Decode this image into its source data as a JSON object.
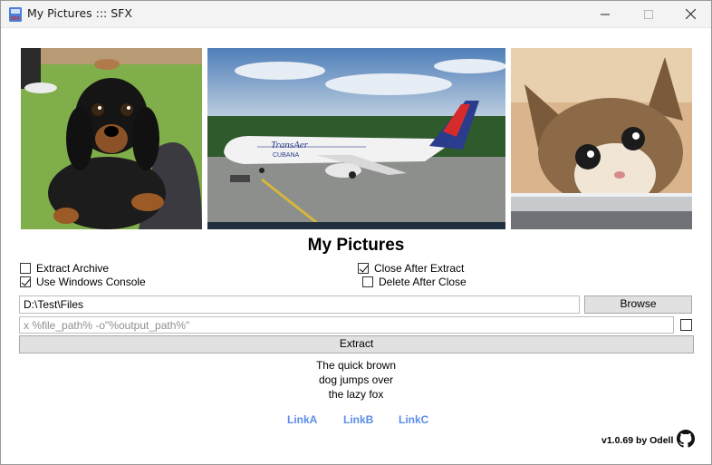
{
  "window": {
    "title": "My Pictures ::: SFX"
  },
  "images": [
    {
      "name": "dachshund-puppy-photo"
    },
    {
      "name": "airplane-photo"
    },
    {
      "name": "kitten-photo"
    }
  ],
  "heading": "My Pictures",
  "options": {
    "extract_archive": {
      "label": "Extract Archive",
      "checked": false
    },
    "use_windows_console": {
      "label": "Use Windows Console",
      "checked": true
    },
    "close_after_extract": {
      "label": "Close After Extract",
      "checked": true
    },
    "delete_after_close": {
      "label": "Delete After Close",
      "checked": false
    }
  },
  "path": {
    "value": "D:\\Test\\Files"
  },
  "browse_label": "Browse",
  "command": {
    "placeholder": "x %file_path% -o\"%output_path%\""
  },
  "extract_label": "Extract",
  "description": [
    "The quick brown",
    "dog jumps over",
    "the lazy fox"
  ],
  "links": [
    "LinkA",
    "LinkB",
    "LinkC"
  ],
  "version": "v1.0.69 by Odell",
  "colors": {
    "link": "#5b8de8",
    "button_bg": "#e1e1e1",
    "titlebar_bg": "#f3f3f3"
  },
  "icons": {
    "app": "sfx-archive-icon",
    "github": "github-icon"
  }
}
